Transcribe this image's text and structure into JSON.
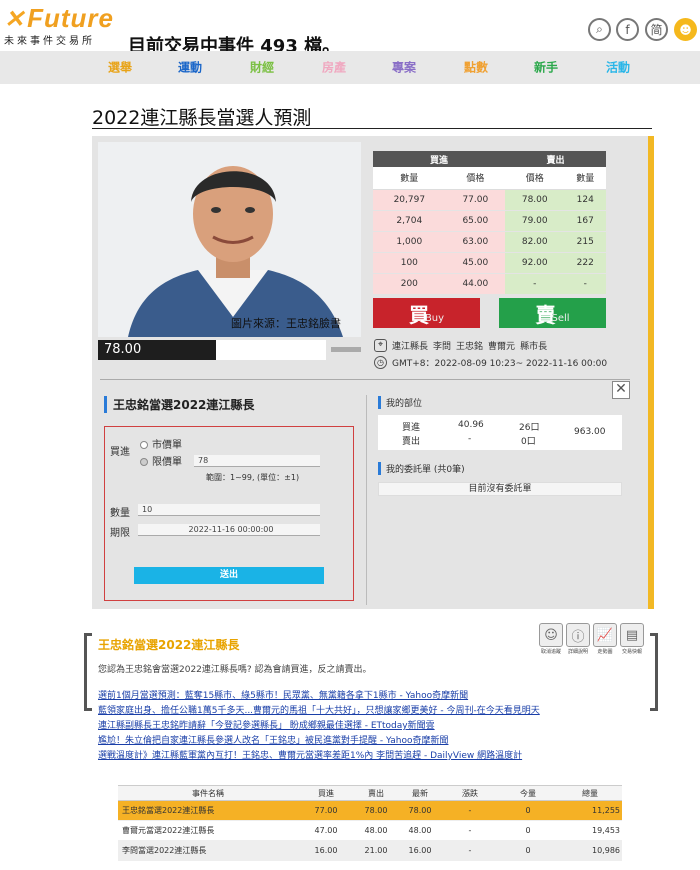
{
  "header": {
    "logo_text": "Future",
    "logo_x": "✕",
    "logo_subtitle": "未來事件交易所",
    "headline": "目前交易中事件 493 檔。",
    "icons": [
      {
        "name": "search-icon",
        "glyph": "⌕"
      },
      {
        "name": "facebook-icon",
        "glyph": "f"
      },
      {
        "name": "simplified-chinese-icon",
        "glyph": "简"
      },
      {
        "name": "user-icon",
        "glyph": "☻"
      }
    ]
  },
  "nav": [
    {
      "label": "選舉",
      "color": "#e8a317"
    },
    {
      "label": "運動",
      "color": "#1a66c9"
    },
    {
      "label": "財經",
      "color": "#7bc043"
    },
    {
      "label": "房產",
      "color": "#f0a8c0"
    },
    {
      "label": "專案",
      "color": "#8a6fc7"
    },
    {
      "label": "點數",
      "color": "#f0a030"
    },
    {
      "label": "新手",
      "color": "#2aa84a"
    },
    {
      "label": "活動",
      "color": "#29b6e8"
    }
  ],
  "page_title": "2022連江縣長當選人預測",
  "photo": {
    "caption": "圖片來源：王忠銘臉書"
  },
  "current_price": "78.00",
  "order_book": {
    "buy_header": "買進",
    "sell_header": "賣出",
    "sub_headers": [
      "數量",
      "價格",
      "價格",
      "數量"
    ],
    "rows": [
      {
        "bid_qty": "20,797",
        "bid_price": "77.00",
        "ask_price": "78.00",
        "ask_qty": "124"
      },
      {
        "bid_qty": "2,704",
        "bid_price": "65.00",
        "ask_price": "79.00",
        "ask_qty": "167"
      },
      {
        "bid_qty": "1,000",
        "bid_price": "63.00",
        "ask_price": "82.00",
        "ask_qty": "215"
      },
      {
        "bid_qty": "100",
        "bid_price": "45.00",
        "ask_price": "92.00",
        "ask_qty": "222"
      },
      {
        "bid_qty": "200",
        "bid_price": "44.00",
        "ask_price": "-",
        "ask_qty": "-"
      }
    ]
  },
  "buy_button": {
    "label": "買",
    "sub": "Buy"
  },
  "sell_button": {
    "label": "賣",
    "sub": "Sell"
  },
  "tags": [
    "連江縣長",
    "李問",
    "王忠銘",
    "曹爾元",
    "縣市長"
  ],
  "time_range": "GMT+8：2022-08-09 10:23~ 2022-11-16 00:00",
  "order_form": {
    "title": "王忠銘當選2022連江縣長",
    "side_label": "買進",
    "market_label": "市價單",
    "limit_label": "限價單",
    "limit_value": "78",
    "range_hint": "範圍：1~99, (單位：±1)",
    "qty_label": "數量",
    "qty_value": "10",
    "expiry_label": "期限",
    "expiry_value": "2022-11-16 00:00:00",
    "submit_label": "送出"
  },
  "position": {
    "title": "我的部位",
    "buy_label": "買進",
    "sell_label": "賣出",
    "buy_price": "40.96",
    "sell_price": "-",
    "buy_qty": "26口",
    "sell_qty": "0口",
    "total": "963.00"
  },
  "orders": {
    "title": "我的委託單 (共0筆)",
    "empty": "目前沒有委託單"
  },
  "info": {
    "title": "王忠銘當選2022連江縣長",
    "question": "您認為王忠銘會當選2022連江縣長嗎? 認為會請買進，反之請賣出。",
    "tools": [
      {
        "name": "unfollow-icon",
        "glyph": "☺",
        "label": "取消追蹤"
      },
      {
        "name": "info-icon",
        "glyph": "ⓘ",
        "label": "詳細說明"
      },
      {
        "name": "trend-chart-icon",
        "glyph": "📈",
        "label": "走勢圖"
      },
      {
        "name": "newspaper-icon",
        "glyph": "▤",
        "label": "交易快報"
      }
    ],
    "news": [
      "選前1個月當選預測：藍奪15縣市、綠5縣市！民眾黨、無黨籍各拿下1縣市 - Yahoo奇摩新聞",
      "藍領家庭出身、擔任公職1萬5千多天...曹爾元的馬祖「十大共好」，只想讓家鄉更美好 - 今周刊-在今天看見明天",
      "連江縣副縣長王忠銘昨請辭「今登記參選縣長」 盼成鄉親最佳選擇 - ETtoday新聞雲",
      "尷尬！朱立倫把自家連江縣長參選人改名「王銘忠」被民進黨對手提醒 - Yahoo奇摩新聞",
      "選戰溫度計》連江縣藍軍黨內互打！王銘忠、曹爾元當選率差距1%內 李問苦追趕 - DailyView 網路溫度計"
    ]
  },
  "event_table": {
    "headers": [
      "事件名稱",
      "買進",
      "賣出",
      "最新",
      "漲跌",
      "今量",
      "總量"
    ],
    "rows": [
      [
        "王忠銘當選2022連江縣長",
        "77.00",
        "78.00",
        "78.00",
        "-",
        "0",
        "11,255"
      ],
      [
        "曹爾元當選2022連江縣長",
        "47.00",
        "48.00",
        "48.00",
        "-",
        "0",
        "19,453"
      ],
      [
        "李問當選2022連江縣長",
        "16.00",
        "21.00",
        "16.00",
        "-",
        "0",
        "10,986"
      ]
    ]
  }
}
